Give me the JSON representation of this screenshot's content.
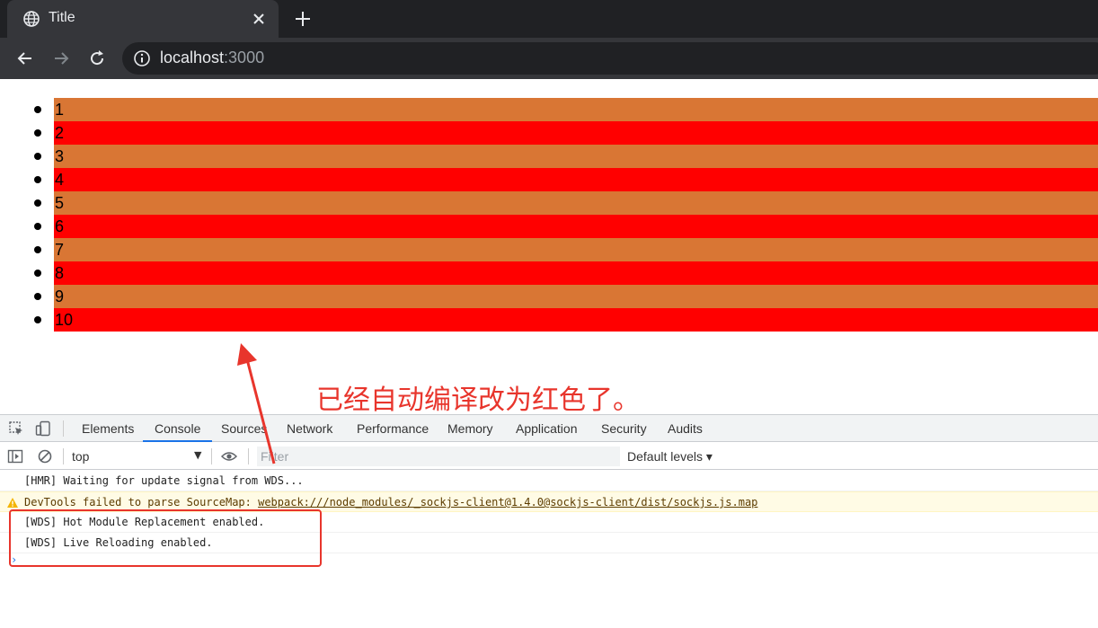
{
  "browser": {
    "tab_title": "Title",
    "url_host": "localhost",
    "url_port": ":3000"
  },
  "page": {
    "items": [
      "1",
      "2",
      "3",
      "4",
      "5",
      "6",
      "7",
      "8",
      "9",
      "10"
    ],
    "colors": {
      "odd": "#d97634",
      "even": "#ff0000"
    }
  },
  "annotation": {
    "text": "已经自动编译改为红色了。",
    "color": "#e8352c"
  },
  "devtools": {
    "tabs": [
      "Elements",
      "Console",
      "Sources",
      "Network",
      "Performance",
      "Memory",
      "Application",
      "Security",
      "Audits"
    ],
    "active_tab": "Console",
    "context": "top",
    "filter_placeholder": "Filter",
    "levels": "Default levels ▾",
    "messages": {
      "m1": "[HMR] Waiting for update signal from WDS...",
      "m2_prefix": "DevTools failed to parse SourceMap: ",
      "m2_link": "webpack:///node_modules/_sockjs-client@1.4.0@sockjs-client/dist/sockjs.js.map",
      "m3": "[WDS] Hot Module Replacement enabled.",
      "m4": "[WDS] Live Reloading enabled."
    },
    "prompt": "›"
  }
}
